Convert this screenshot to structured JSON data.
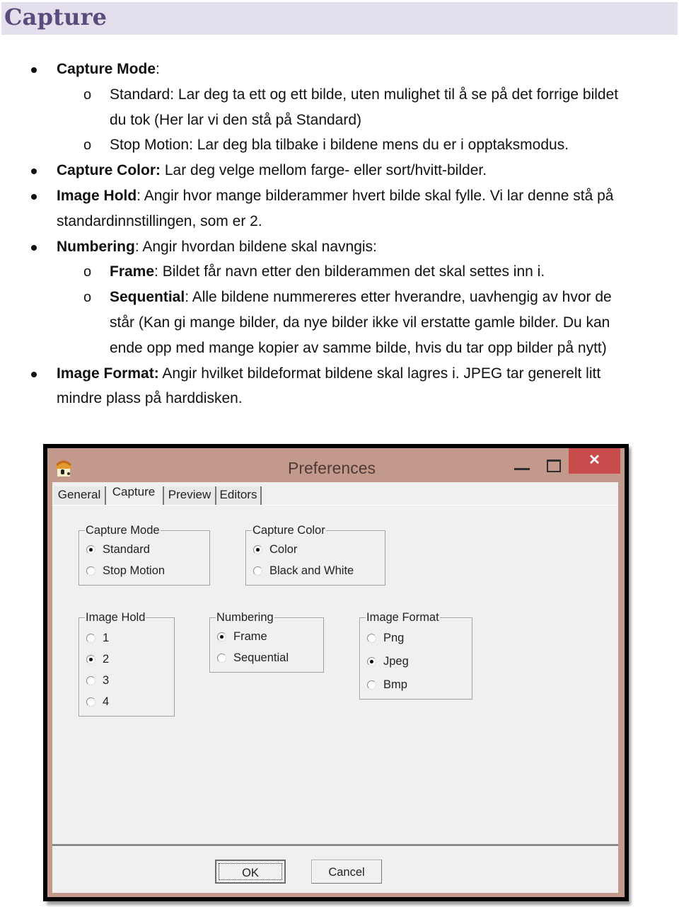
{
  "heading": "Capture",
  "doc": {
    "items": [
      {
        "bold": "Capture Mode",
        "text": ":"
      },
      {
        "sub": true,
        "bold": "",
        "text": "Standard: Lar deg ta ett og ett bilde, uten mulighet til å se på det forrige bildet"
      },
      {
        "cont": true,
        "text": "du tok (Her lar vi den stå på Standard)"
      },
      {
        "sub": true,
        "bold": "",
        "text": "Stop Motion: Lar deg bla tilbake i bildene mens du er i opptaksmodus."
      },
      {
        "bold": "Capture Color:",
        "text": " Lar deg velge mellom farge- eller sort/hvitt-bilder."
      },
      {
        "bold": "Image Hold",
        "text": ": Angir hvor mange bilderammer hvert bilde skal fylle. Vi lar denne stå på"
      },
      {
        "cont": true,
        "text": "standardinnstillingen, som er 2."
      },
      {
        "bold": "Numbering",
        "text": ": Angir hvordan bildene skal navngis:"
      },
      {
        "sub": true,
        "bold": "Frame",
        "text": ": Bildet får navn etter den bilderammen det skal settes inn i."
      },
      {
        "sub": true,
        "bold": "Sequential",
        "text": ": Alle bildene nummereres etter hverandre, uavhengig av hvor de"
      },
      {
        "cont": true,
        "text": "står (Kan gi mange bilder, da nye bilder ikke vil erstatte gamle bilder. Du kan"
      },
      {
        "cont": true,
        "text": "ende opp med mange kopier av samme bilde, hvis du tar opp bilder på nytt)"
      },
      {
        "bold": "Image Format:",
        "text": " Angir hvilket bildeformat bildene skal lagres i. JPEG tar generelt litt"
      },
      {
        "cont": true,
        "text": "mindre plass på harddisken."
      }
    ],
    "sub_bullet_glyph": "o"
  },
  "dialog": {
    "title": "Preferences",
    "close_glyph": "✕",
    "icons": {
      "app": "app-house-icon",
      "minimize": "minimize-icon",
      "maximize": "maximize-icon",
      "close": "close-icon"
    },
    "tabs": [
      {
        "label": "General",
        "active": false
      },
      {
        "label": "Capture",
        "active": true
      },
      {
        "label": "Preview",
        "active": false
      },
      {
        "label": "Editors",
        "active": false
      }
    ],
    "groups": {
      "capture_mode": {
        "label": "Capture Mode",
        "options": [
          "Standard",
          "Stop Motion"
        ],
        "selected": "Standard"
      },
      "capture_color": {
        "label": "Capture Color",
        "options": [
          "Color",
          "Black and White"
        ],
        "selected": "Color"
      },
      "image_hold": {
        "label": "Image Hold",
        "options": [
          "1",
          "2",
          "3",
          "4"
        ],
        "selected": "2"
      },
      "numbering": {
        "label": "Numbering",
        "options": [
          "Frame",
          "Sequential"
        ],
        "selected": "Frame"
      },
      "image_format": {
        "label": "Image Format",
        "options": [
          "Png",
          "Jpeg",
          "Bmp"
        ],
        "selected": "Jpeg"
      }
    },
    "buttons": {
      "ok": "OK",
      "cancel": "Cancel"
    },
    "colors": {
      "frame": "#c3998c",
      "close": "#c94c4c",
      "body": "#f0f0f0"
    }
  }
}
